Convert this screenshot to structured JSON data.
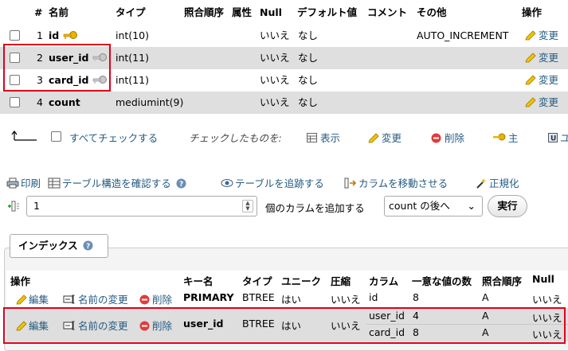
{
  "structure": {
    "headers": [
      "#",
      "名前",
      "タイプ",
      "照合順序",
      "属性",
      "Null",
      "デフォルト値",
      "コメント",
      "その他",
      "操作"
    ],
    "rows": [
      {
        "num": "1",
        "name": "id",
        "type": "int(10)",
        "null": "いいえ",
        "default": "なし",
        "extra": "AUTO_INCREMENT",
        "action": "変更"
      },
      {
        "num": "2",
        "name": "user_id",
        "type": "int(11)",
        "null": "いいえ",
        "default": "なし",
        "extra": "",
        "action": "変更"
      },
      {
        "num": "3",
        "name": "card_id",
        "type": "int(11)",
        "null": "いいえ",
        "default": "なし",
        "extra": "",
        "action": "変更"
      },
      {
        "num": "4",
        "name": "count",
        "type": "mediumint(9)",
        "null": "いいえ",
        "default": "なし",
        "extra": "",
        "action": "変更"
      }
    ]
  },
  "bulk": {
    "check_all": "すべてチェックする",
    "with_selected": "チェックしたものを:",
    "browse": "表示",
    "change": "変更",
    "drop": "削除",
    "primary": "主",
    "unique_cut": "ユ"
  },
  "tools": {
    "print": "印刷",
    "propose": "テーブル構造を確認する",
    "track": "テーブルを追跡する",
    "move_columns": "カラムを移動させる",
    "normalize": "正規化"
  },
  "add_columns": {
    "value": "1",
    "label": "個のカラムを追加する",
    "position": "count の後へ",
    "go": "実行"
  },
  "indexes": {
    "legend": "インデックス",
    "headers": {
      "action": "操作",
      "keyname": "キー名",
      "type": "タイプ",
      "unique": "ユニーク",
      "packed": "圧縮",
      "column": "カラム",
      "cardinality": "一意な値の数",
      "collation": "照合順序",
      "null": "Null"
    },
    "edit": "編集",
    "rename": "名前の変更",
    "drop": "削除",
    "rows": [
      {
        "keyname": "PRIMARY",
        "type": "BTREE",
        "unique": "はい",
        "packed": "いいえ",
        "cols": [
          {
            "column": "id",
            "cardinality": "8",
            "collation": "A",
            "null": "いいえ"
          }
        ]
      },
      {
        "keyname": "user_id",
        "type": "BTREE",
        "unique": "はい",
        "packed": "いいえ",
        "cols": [
          {
            "column": "user_id",
            "cardinality": "4",
            "collation": "A",
            "null": "いいえ"
          },
          {
            "column": "card_id",
            "cardinality": "8",
            "collation": "A",
            "null": "いいえ"
          }
        ]
      }
    ]
  },
  "colors": {
    "link": "#235a81",
    "highlight": "#e0001b",
    "row_alt": "#dfdfdf"
  }
}
